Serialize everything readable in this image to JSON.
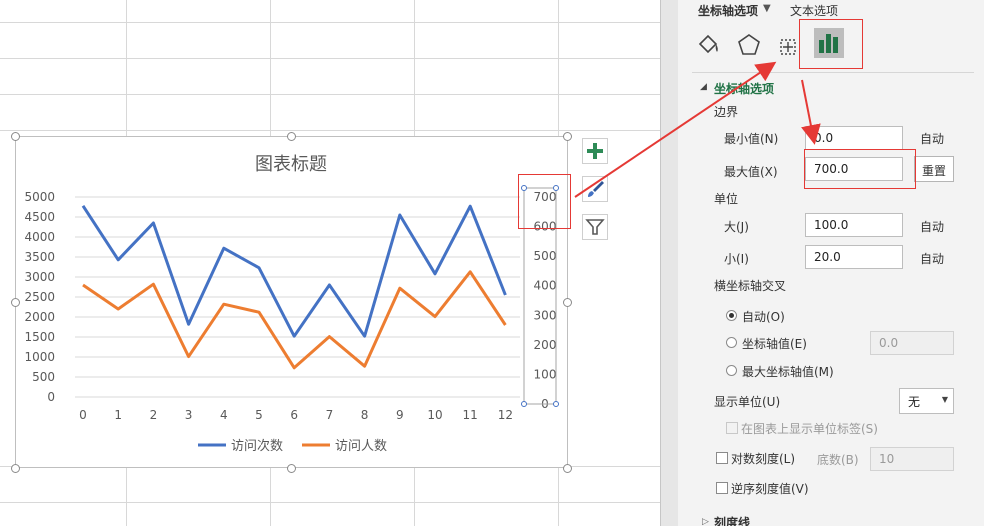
{
  "panel": {
    "tab_axis_options": "坐标轴选项",
    "tab_text_options": "文本选项",
    "section_axis": "坐标轴选项",
    "bounds_label": "边界",
    "min_label": "最小值(N)",
    "min_value": "0.0",
    "min_auto": "自动",
    "max_label": "最大值(X)",
    "max_value": "700.0",
    "reset_button": "重置",
    "unit_label": "单位",
    "major_label": "大(J)",
    "major_value": "100.0",
    "major_auto": "自动",
    "minor_label": "小(I)",
    "minor_value": "20.0",
    "minor_auto": "自动",
    "cross_label": "横坐标轴交叉",
    "cross_auto": "自动(O)",
    "cross_value_label": "坐标轴值(E)",
    "cross_value": "0.0",
    "cross_max_label": "最大坐标轴值(M)",
    "display_unit_label": "显示单位(U)",
    "display_unit_value": "无",
    "show_unit_label": "在图表上显示单位标签(S)",
    "log_scale_label": "对数刻度(L)",
    "log_base_label": "底数(B)",
    "log_base_value": "10",
    "reverse_label": "逆序刻度值(V)",
    "next_section": "刻度线"
  },
  "colors": {
    "series1": "#4472c4",
    "series2": "#ed7d31",
    "accent_green": "#217346",
    "annotation_red": "#e53935"
  },
  "chart_data": {
    "type": "line",
    "title": "图表标题",
    "x": [
      0,
      1,
      2,
      3,
      4,
      5,
      6,
      7,
      8,
      9,
      10,
      11,
      12
    ],
    "x_tick_labels": [
      "0",
      "1",
      "2",
      "3",
      "4",
      "5",
      "6",
      "7",
      "8",
      "9",
      "10",
      "11",
      "12"
    ],
    "y_tick_labels": [
      "5000",
      "4500",
      "4000",
      "3500",
      "3000",
      "2500",
      "2000",
      "1500",
      "1000",
      "500",
      "0"
    ],
    "y2_tick_labels": [
      "700",
      "600",
      "500",
      "400",
      "300",
      "200",
      "100",
      "0"
    ],
    "ylim": [
      0,
      5000
    ],
    "y2lim": [
      0,
      700
    ],
    "grid": true,
    "legend_position": "bottom",
    "series": [
      {
        "name": "访问次数",
        "values": [
          4780,
          3430,
          4350,
          1820,
          3720,
          3230,
          1520,
          2800,
          1520,
          4550,
          3080,
          4770,
          2550
        ]
      },
      {
        "name": "访问人数",
        "values": [
          2800,
          2200,
          2820,
          1010,
          2320,
          2120,
          730,
          1510,
          770,
          2720,
          2010,
          3130,
          1800
        ]
      }
    ]
  }
}
